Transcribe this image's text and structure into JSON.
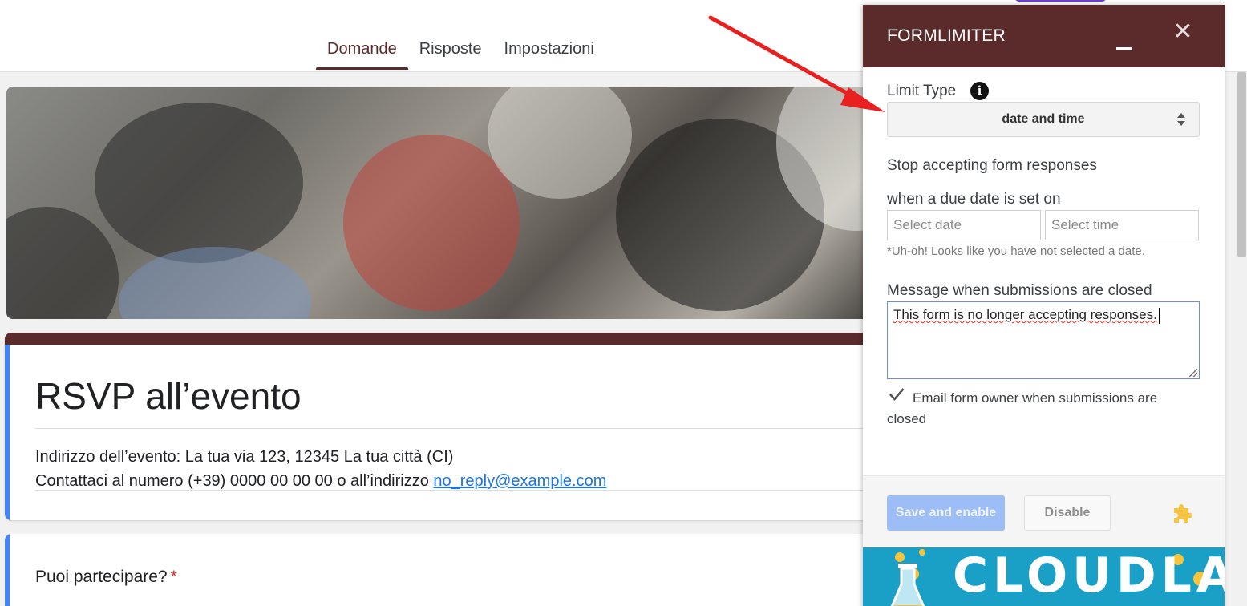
{
  "nav": {
    "tabs": [
      {
        "label": "Domande",
        "active": true
      },
      {
        "label": "Risposte",
        "active": false
      },
      {
        "label": "Impostazioni",
        "active": false
      }
    ]
  },
  "form": {
    "title": "RSVP all’evento",
    "description_line1": "Indirizzo dell’evento: La tua via 123, 12345 La tua città (CI)",
    "description_line2_prefix": "Contattaci al numero (+39) 0000 00 00 00 o all’indirizzo ",
    "email_link": "no_reply@example.com",
    "question": {
      "label": "Puoi partecipare?",
      "required_mark": "*"
    }
  },
  "panel": {
    "title": "FORMLIMITER",
    "close_symbol": "✕",
    "limit_type_label": "Limit Type",
    "info_symbol": "i",
    "limit_type_value": "date and time",
    "stop_label": "Stop accepting form responses",
    "due_label": "when a due date is set on",
    "date_placeholder": "Select date",
    "time_placeholder": "Select time",
    "warning": "*Uh-oh! Looks like you have not selected a date.",
    "message_label": "Message when submissions are closed",
    "message_value": "This form is no longer accepting responses.",
    "email_owner_label": "Email form owner when submissions are closed",
    "email_owner_checked": true,
    "save_label": "Save and enable",
    "disable_label": "Disable",
    "banner_text": "CLOUDLAB"
  },
  "colors": {
    "brand": "#5b2a2a",
    "accent_blue": "#4285f4",
    "save_button": "#9dbdf7",
    "arrow": "#e8201f"
  },
  "icons": [
    "info-icon",
    "minimize-icon",
    "close-icon",
    "select-arrows-icon",
    "checkmark-icon",
    "puzzle-icon",
    "flask-icon"
  ]
}
